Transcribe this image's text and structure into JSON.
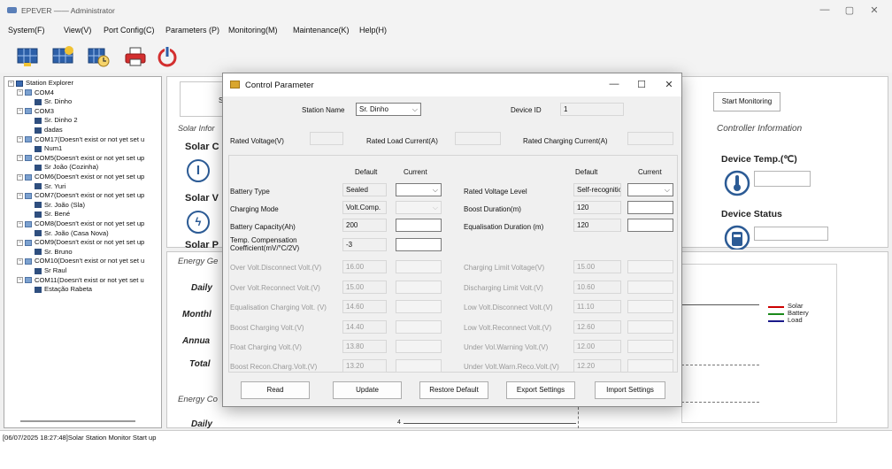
{
  "window": {
    "title": "EPEVER —— Administrator",
    "minimize": "—",
    "maximize": "▢",
    "close": "✕"
  },
  "menu": [
    "System(F)",
    "View(V)",
    "Port Config(C)",
    "Parameters (P)",
    "Monitoring(M)",
    "Maintenance(K)",
    "Help(H)"
  ],
  "toolbar_icons": [
    "solar-panel-icon",
    "solar-add-icon",
    "solar-clock-icon",
    "printer-icon",
    "power-icon"
  ],
  "explorer": {
    "items": [
      {
        "label": "Station Explorer",
        "level": 0,
        "pm": "−",
        "icon": "pc"
      },
      {
        "label": "COM4",
        "level": 1,
        "pm": "−",
        "icon": "port"
      },
      {
        "label": "Sr. Dinho",
        "level": 2,
        "pm": "",
        "icon": "dev"
      },
      {
        "label": "COM3",
        "level": 1,
        "pm": "−",
        "icon": "port"
      },
      {
        "label": "Sr. Dinho 2",
        "level": 2,
        "pm": "",
        "icon": "dev"
      },
      {
        "label": "dadas",
        "level": 2,
        "pm": "",
        "icon": "dev"
      },
      {
        "label": "COM17(Doesn't exist or not yet set u",
        "level": 1,
        "pm": "−",
        "icon": "port"
      },
      {
        "label": "Num1",
        "level": 2,
        "pm": "",
        "icon": "dev"
      },
      {
        "label": "COM5(Doesn't exist or not yet set up",
        "level": 1,
        "pm": "−",
        "icon": "port"
      },
      {
        "label": "Sr João (Cozinha)",
        "level": 2,
        "pm": "",
        "icon": "dev"
      },
      {
        "label": "COM6(Doesn't exist or not yet set up",
        "level": 1,
        "pm": "−",
        "icon": "port"
      },
      {
        "label": "Sr. Yuri",
        "level": 2,
        "pm": "",
        "icon": "dev"
      },
      {
        "label": "COM7(Doesn't exist or not yet set up",
        "level": 1,
        "pm": "−",
        "icon": "port"
      },
      {
        "label": "Sr. João (Sla)",
        "level": 2,
        "pm": "",
        "icon": "dev"
      },
      {
        "label": "Sr. Bené",
        "level": 2,
        "pm": "",
        "icon": "dev"
      },
      {
        "label": "COM8(Doesn't exist or not yet set up",
        "level": 1,
        "pm": "−",
        "icon": "port"
      },
      {
        "label": "Sr. João (Casa Nova)",
        "level": 2,
        "pm": "",
        "icon": "dev"
      },
      {
        "label": "COM9(Doesn't exist or not yet set up",
        "level": 1,
        "pm": "−",
        "icon": "port"
      },
      {
        "label": "Sr. Bruno",
        "level": 2,
        "pm": "",
        "icon": "dev"
      },
      {
        "label": "COM10(Doesn't exist or not yet set u",
        "level": 1,
        "pm": "−",
        "icon": "port"
      },
      {
        "label": "Sr Raul",
        "level": 2,
        "pm": "",
        "icon": "dev"
      },
      {
        "label": "COM11(Doesn't exist or not yet set u",
        "level": 1,
        "pm": "−",
        "icon": "port"
      },
      {
        "label": "Estação Rabeta",
        "level": 2,
        "pm": "",
        "icon": "dev"
      }
    ]
  },
  "background": {
    "solar_info": "Solar Infor",
    "solar_c": "Solar C",
    "solar_v": "Solar V",
    "solar_p": "Solar P",
    "energy_ge": "Energy Ge",
    "daily": "Daily",
    "monthly": "Monthl",
    "annual": "Annua",
    "total": "Total",
    "energy_co": "Energy Co",
    "daily2": "Daily",
    "s_letter": "S",
    "start_monitoring": "Start Monitoring",
    "controller_info": "Controller Information",
    "device_temp": "Device Temp.(℃)",
    "device_status": "Device Status",
    "axis_tick": "4",
    "legend": [
      {
        "name": "Solar",
        "color": "#cc0000"
      },
      {
        "name": "Battery",
        "color": "#1a8a1a"
      },
      {
        "name": "Load",
        "color": "#1a1a8a"
      }
    ]
  },
  "status_bar": "[06/07/2025 18:27:48]Solar Station Monitor Start up",
  "dialog": {
    "title": "Control Parameter",
    "minimize": "—",
    "maximize": "☐",
    "close": "✕",
    "station_name_label": "Station Name",
    "station_name_value": "Sr. Dinho",
    "device_id_label": "Device ID",
    "device_id_value": "1",
    "rated_voltage_label": "Rated Voltage(V)",
    "rated_load_current_label": "Rated Load Current(A)",
    "rated_charging_current_label": "Rated Charging Current(A)",
    "col_default": "Default",
    "col_current": "Current",
    "left_rows": [
      {
        "label": "Battery Type",
        "default": "Sealed",
        "current": "",
        "current_dropdown": true,
        "enabled": true
      },
      {
        "label": "Charging Mode",
        "default": "Volt.Comp.",
        "current": "",
        "current_dropdown": true,
        "enabled": false
      },
      {
        "label": "Battery Capacity(Ah)",
        "default": "200",
        "current": "",
        "current_dropdown": false,
        "enabled": true
      },
      {
        "label": "Temp. Compensation Coefficient(mV/°C/2V)",
        "default": "-3",
        "current": "",
        "current_dropdown": false,
        "enabled": true
      }
    ],
    "right_rows": [
      {
        "label": "Rated Voltage Level",
        "default": "Self-recognitio",
        "current": "",
        "current_dropdown": true
      },
      {
        "label": "Boost Duration(m)",
        "default": "120",
        "current": "",
        "current_dropdown": false
      },
      {
        "label": "Equalisation Duration (m)",
        "default": "120",
        "current": "",
        "current_dropdown": false
      }
    ],
    "left_gray_rows": [
      {
        "label": "Over Volt.Disconnect Volt.(V)",
        "default": "16.00"
      },
      {
        "label": "Over Volt.Reconnect Volt.(V)",
        "default": "15.00"
      },
      {
        "label": "Equalisation Charging Volt. (V)",
        "default": "14.60"
      },
      {
        "label": "Boost Charging Volt.(V)",
        "default": "14.40"
      },
      {
        "label": "Float Charging Volt.(V)",
        "default": "13.80"
      },
      {
        "label": "Boost Recon.Charg.Volt.(V)",
        "default": "13.20"
      }
    ],
    "right_gray_rows": [
      {
        "label": "Charging Limit Voltage(V)",
        "default": "15.00"
      },
      {
        "label": "Discharging Limit Volt.(V)",
        "default": "10.60"
      },
      {
        "label": "Low Volt.Disconnect Volt.(V)",
        "default": "11.10"
      },
      {
        "label": "Low Volt.Reconnect Volt.(V)",
        "default": "12.60"
      },
      {
        "label": "Under Vol.Warning Volt.(V)",
        "default": "12.00"
      },
      {
        "label": "Under Volt.Warn.Reco.Volt.(V)",
        "default": "12.20"
      }
    ],
    "buttons": [
      "Read",
      "Update",
      "Restore Default",
      "Export Settings",
      "Import Settings"
    ]
  }
}
